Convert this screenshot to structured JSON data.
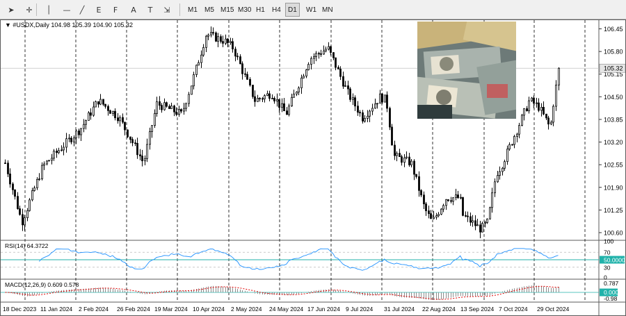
{
  "toolbar": {
    "tools": [
      {
        "name": "cursor-arrow-icon",
        "glyph": "➤"
      },
      {
        "name": "crosshair-icon",
        "glyph": "✛"
      },
      {
        "name": "vertical-line-icon",
        "glyph": "│"
      },
      {
        "name": "horizontal-line-icon",
        "glyph": "—"
      },
      {
        "name": "trendline-icon",
        "glyph": "╱"
      },
      {
        "name": "equidistant-channel-icon",
        "glyph": "E"
      },
      {
        "name": "fibonacci-retracement-icon",
        "glyph": "F"
      },
      {
        "name": "text-label-icon",
        "glyph": "A"
      },
      {
        "name": "text-box-icon",
        "glyph": "T"
      },
      {
        "name": "arrows-shapes-icon",
        "glyph": "⇲"
      }
    ],
    "timeframes": [
      "M1",
      "M5",
      "M15",
      "M30",
      "H1",
      "H4",
      "D1",
      "W1",
      "MN"
    ],
    "active_timeframe": "D1"
  },
  "chart": {
    "header": "#USDX,Daily  104.98 105.39 104.90 105.32",
    "symbol_prefix": "▼",
    "current_price": "105.32",
    "price_labels": [
      "106.45",
      "105.80",
      "105.15",
      "104.50",
      "103.85",
      "103.20",
      "102.55",
      "101.90",
      "101.25",
      "100.60"
    ],
    "date_labels": [
      "18 Dec 2023",
      "11 Jan 2024",
      "2 Feb 2024",
      "26 Feb 2024",
      "19 Mar 2024",
      "10 Apr 2024",
      "2 May 2024",
      "24 May 2024",
      "17 Jun 2024",
      "9 Jul 2024",
      "31 Jul 2024",
      "22 Aug 2024",
      "13 Sep 2024",
      "7 Oct 2024",
      "29 Oct 2024"
    ],
    "colors": {
      "candle": "#000000",
      "grid": "#000000",
      "rsi_line": "#1e90ff",
      "rsi_level": "#20b2aa",
      "macd_signal": "#e00000",
      "macd_hist": "#8c8c8c",
      "price_line": "#c0c0c0"
    }
  },
  "rsi": {
    "label": "RSI(14) 64.3722",
    "levels": [
      "100",
      "70",
      "50.0000",
      "30",
      "0"
    ]
  },
  "macd": {
    "label": "MACD(12,26,9) 0.609 0.578",
    "levels": [
      "0.787",
      "0.000",
      "-0.98"
    ]
  },
  "chart_data": {
    "type": "candlestick",
    "symbol": "#USDX",
    "timeframe": "Daily",
    "last_bar": {
      "open": 104.98,
      "high": 105.39,
      "low": 104.9,
      "close": 105.32
    },
    "ylim": [
      100.4,
      106.7
    ],
    "close_path": [
      [
        "18 Dec 2023",
        102.6
      ],
      [
        "11 Jan 2024",
        102.5
      ],
      [
        "2 Feb 2024",
        103.6
      ],
      [
        "26 Feb 2024",
        103.9
      ],
      [
        "19 Mar 2024",
        104.3
      ],
      [
        "10 Apr 2024",
        105.2
      ],
      [
        "2 May 2024",
        105.9
      ],
      [
        "24 May 2024",
        104.6
      ],
      [
        "17 Jun 2024",
        105.6
      ],
      [
        "9 Jul 2024",
        104.6
      ],
      [
        "31 Jul 2024",
        104.4
      ],
      [
        "22 Aug 2024",
        101.3
      ],
      [
        "13 Sep 2024",
        101.1
      ],
      [
        "7 Oct 2024",
        102.5
      ],
      [
        "29 Oct 2024",
        104.2
      ]
    ],
    "indicators": {
      "rsi": 64.3722,
      "macd": 0.609,
      "signal": 0.578
    }
  }
}
